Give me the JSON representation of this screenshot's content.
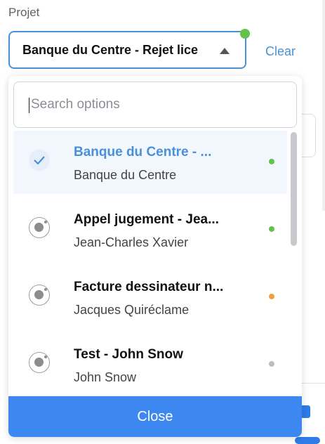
{
  "field": {
    "label": "Projet",
    "selected_value": "Banque du Centre - Rejet lice",
    "status_color": "#62c24a",
    "clear_label": "Clear"
  },
  "dropdown": {
    "search_placeholder": "Search options",
    "search_value": "",
    "close_label": "Close",
    "options": [
      {
        "title": "Banque du Centre - ...",
        "subtitle": "Banque du Centre",
        "status_color": "#62c24a",
        "selected": true,
        "icon": "check-icon"
      },
      {
        "title": "Appel jugement - Jea...",
        "subtitle": "Jean-Charles Xavier",
        "status_color": "#62c24a",
        "selected": false,
        "icon": "radio-icon"
      },
      {
        "title": "Facture dessinateur n...",
        "subtitle": "Jacques Quiréclame",
        "status_color": "#f0a040",
        "selected": false,
        "icon": "radio-icon"
      },
      {
        "title": "Test - John Snow",
        "subtitle": "John Snow",
        "status_color": "#bdbdbd",
        "selected": false,
        "icon": "radio-icon"
      }
    ]
  },
  "colors": {
    "accent": "#4a90d9",
    "button": "#3d88f0"
  }
}
